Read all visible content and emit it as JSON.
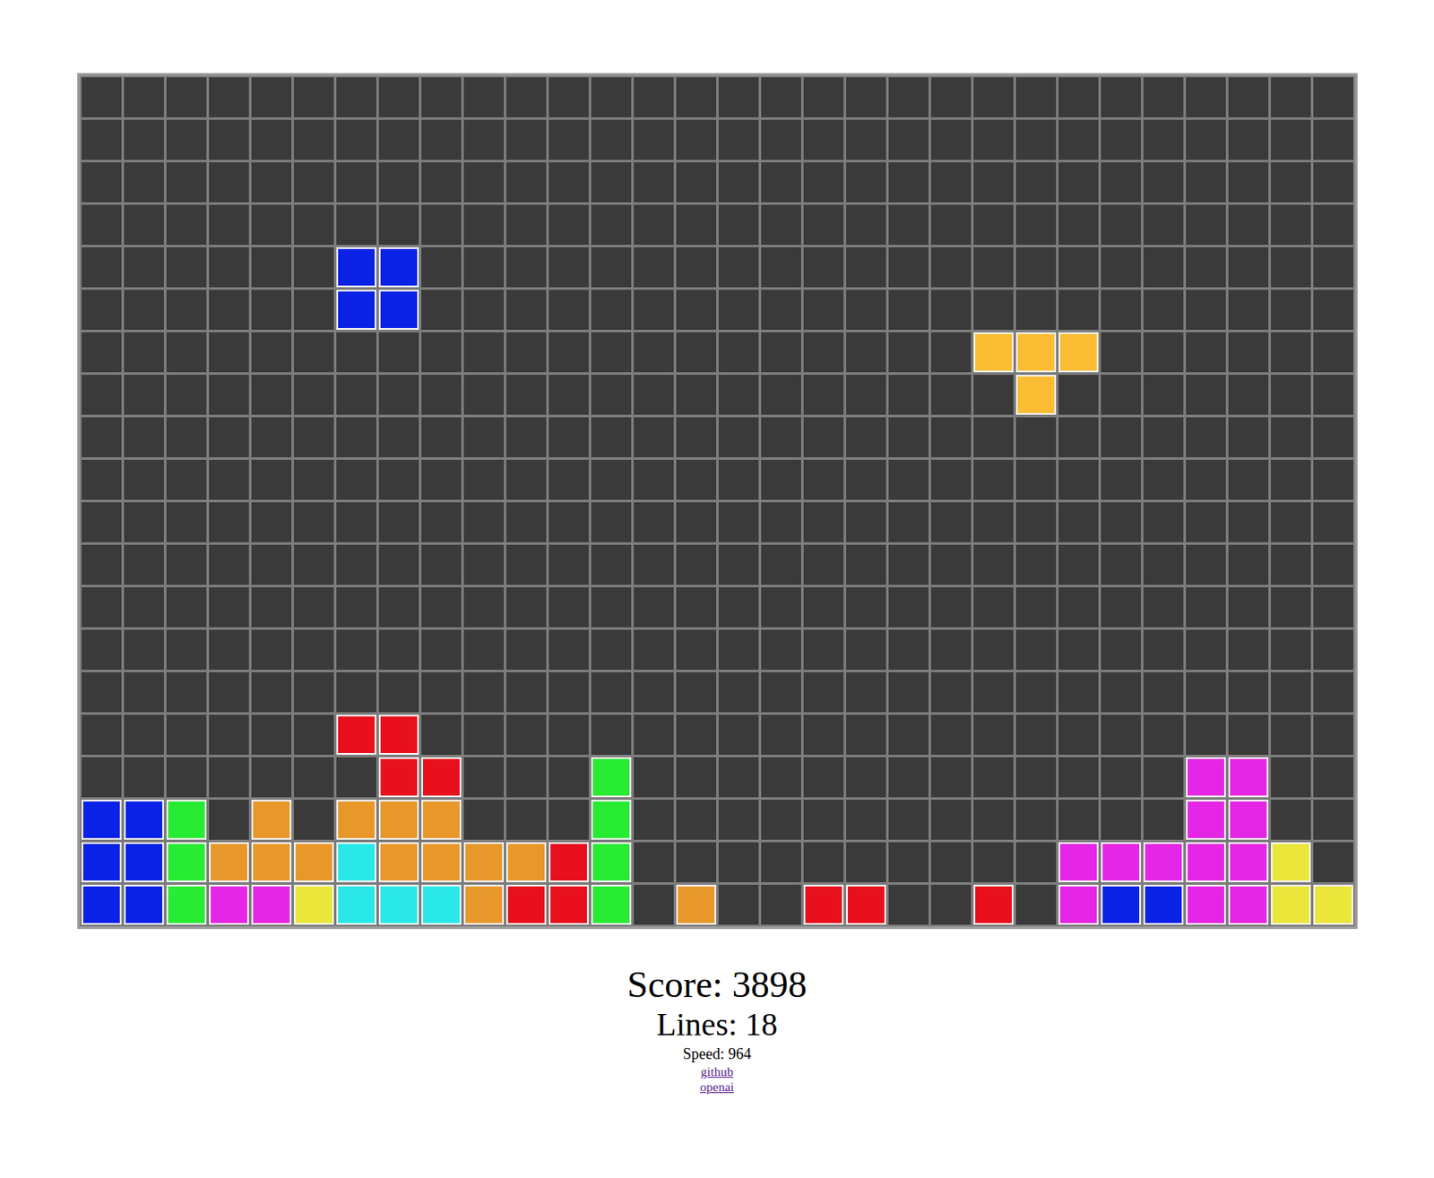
{
  "board": {
    "columns": 30,
    "rows": [
      "..............................",
      "..............................",
      "..............................",
      "..............................",
      "......BB......................",
      "......BB......................",
      ".....................TTT......",
      "......................T.......",
      "..............................",
      "..............................",
      "..............................",
      "..............................",
      "..............................",
      "..............................",
      "..............................",
      "......RR......................",
      ".......RR...G.............MM..",
      "BBG.O.OOO...G.............MM..",
      "BBGOOOCOOOORG..........MMMMMY.",
      "BBGMMYCCCORRG.O..RR..R.MBBMMYY"
    ],
    "palette": {
      "B": "#0a22e6",
      "G": "#27ec33",
      "O": "#e8982a",
      "M": "#e626e6",
      "Y": "#ebe63a",
      "C": "#2ae8e8",
      "R": "#e8101c",
      "T": "#fbbd33"
    }
  },
  "score": "Score: 3898",
  "lines": "Lines: 18",
  "speed": "Speed: 964",
  "links": [
    "github",
    "openai"
  ]
}
